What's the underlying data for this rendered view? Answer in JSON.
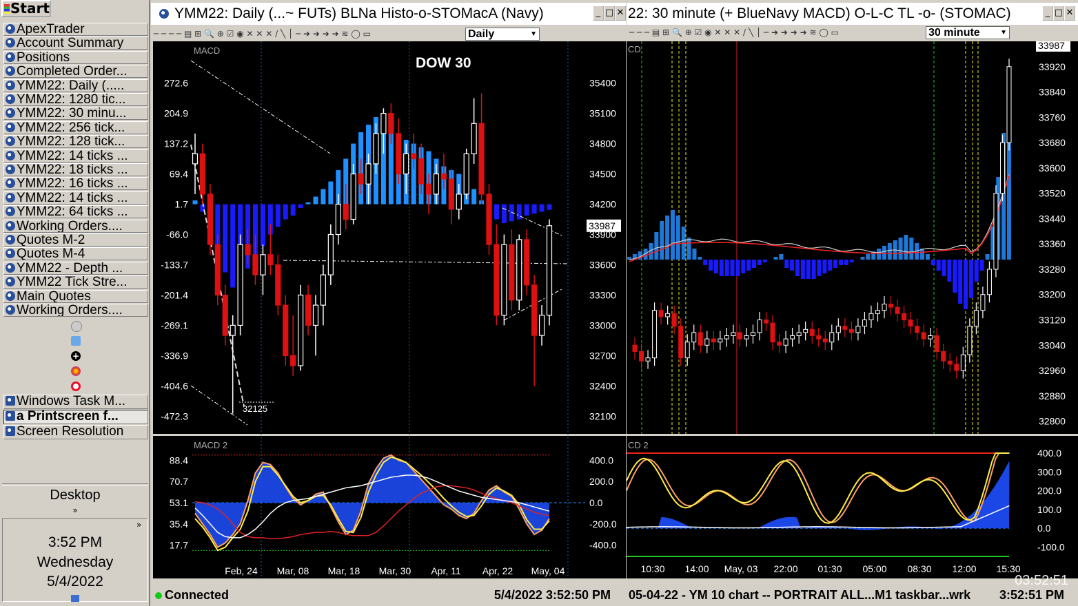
{
  "taskbar": {
    "start_label": "Start",
    "items": [
      {
        "label": "ApexTrader"
      },
      {
        "label": "Account Summary"
      },
      {
        "label": "Positions"
      },
      {
        "label": "Completed Order..."
      },
      {
        "label": "YMM22: Daily (....."
      },
      {
        "label": "YMM22: 1280 tic..."
      },
      {
        "label": "YMM22: 30 minu..."
      },
      {
        "label": "YMM22: 256 tick..."
      },
      {
        "label": "YMM22: 128 tick..."
      },
      {
        "label": "YMM22: 14 ticks ..."
      },
      {
        "label": "YMM22: 18 ticks ..."
      },
      {
        "label": "YMM22: 16 ticks ..."
      },
      {
        "label": "YMM22: 14 ticks ..."
      },
      {
        "label": "YMM22: 64 ticks ..."
      },
      {
        "label": "Working Orders...."
      },
      {
        "label": "Quotes M-2"
      },
      {
        "label": "Quotes M-4"
      },
      {
        "label": "YMM22 - Depth ..."
      },
      {
        "label": "YMM22 Tick Stre..."
      },
      {
        "label": "Main Quotes"
      },
      {
        "label": "Working Orders...."
      }
    ],
    "bottom_items": [
      {
        "label": "Windows Task M..."
      },
      {
        "label": "a Printscreen f..."
      },
      {
        "label": "Screen Resolution"
      }
    ],
    "desktop_label": "Desktop",
    "desktop_chevron": "»",
    "tray_chevron": "»",
    "clock": {
      "time": "3:52 PM",
      "day": "Wednesday",
      "date": "5/4/2022"
    }
  },
  "left_window": {
    "title": "YMM22: Daily (...~ FUTs) BLNa Histo-o-STOMacA (Navy)",
    "timeframe": "Daily",
    "chart_title": "DOW 30",
    "status_connected": "Connected",
    "status_time": "5/4/2022 3:52:50 PM"
  },
  "right_window": {
    "title": "22: 30 minute (+ BlueNavy MACD) O-L-C TL -o- (STOMAC)",
    "timeframe": "30 minute",
    "status_text": "05-04-22 -  YM 10 chart -- PORTRAIT ALL...M1 taskbar...wrk",
    "status_time": "3:52:51 PM",
    "clock_overlay": "03:52:51"
  },
  "colors": {
    "up": "#ffffff",
    "down": "#dd1111",
    "hist_up": "#1e90ff",
    "hist_down": "#1a1aff",
    "price_tag": "#ffffff"
  },
  "chart_data": [
    {
      "type": "candlestick",
      "title": "DOW 30",
      "panel_label": "MACD",
      "x_tick_labels": [
        "Feb, 24",
        "Mar, 08",
        "Mar, 18",
        "Mar, 30",
        "Apr, 11",
        "Apr, 22",
        "May, 04"
      ],
      "price_axis": [
        35400,
        35100,
        34800,
        34500,
        34200,
        33900,
        33600,
        33300,
        33000,
        32700,
        32400,
        32100
      ],
      "indicator_axis": [
        272.6,
        204.9,
        137.2,
        69.4,
        1.7,
        -66.0,
        -133.7,
        -201.4,
        -269.1,
        -336.9,
        -404.6,
        -472.3
      ],
      "ylim": [
        32000,
        35500
      ],
      "last_price": 33987,
      "annotation": "32125",
      "candles": [
        {
          "o": 34600,
          "h": 34900,
          "l": 34300,
          "c": 34700
        },
        {
          "o": 34700,
          "h": 34800,
          "l": 34200,
          "c": 34300
        },
        {
          "o": 34300,
          "h": 34400,
          "l": 33700,
          "c": 33800
        },
        {
          "o": 33800,
          "h": 33900,
          "l": 33200,
          "c": 33300
        },
        {
          "o": 33300,
          "h": 33400,
          "l": 32800,
          "c": 32900
        },
        {
          "o": 32900,
          "h": 33100,
          "l": 32125,
          "c": 33000
        },
        {
          "o": 33000,
          "h": 33900,
          "l": 32900,
          "c": 33800
        },
        {
          "o": 33800,
          "h": 33950,
          "l": 33600,
          "c": 33700
        },
        {
          "o": 33700,
          "h": 33900,
          "l": 33400,
          "c": 33500
        },
        {
          "o": 33500,
          "h": 33800,
          "l": 33300,
          "c": 33700
        },
        {
          "o": 33700,
          "h": 34000,
          "l": 33500,
          "c": 33600
        },
        {
          "o": 33600,
          "h": 33700,
          "l": 33100,
          "c": 33200
        },
        {
          "o": 33200,
          "h": 33300,
          "l": 32600,
          "c": 32700
        },
        {
          "o": 32700,
          "h": 33100,
          "l": 32500,
          "c": 32600
        },
        {
          "o": 32600,
          "h": 33400,
          "l": 32550,
          "c": 33300
        },
        {
          "o": 33300,
          "h": 33400,
          "l": 32900,
          "c": 33000
        },
        {
          "o": 33000,
          "h": 33300,
          "l": 32700,
          "c": 33200
        },
        {
          "o": 33200,
          "h": 33600,
          "l": 33000,
          "c": 33500
        },
        {
          "o": 33500,
          "h": 34000,
          "l": 33400,
          "c": 33900
        },
        {
          "o": 33900,
          "h": 34300,
          "l": 33800,
          "c": 34200
        },
        {
          "o": 34200,
          "h": 34400,
          "l": 33950,
          "c": 34050
        },
        {
          "o": 34050,
          "h": 34600,
          "l": 34000,
          "c": 34500
        },
        {
          "o": 34500,
          "h": 34650,
          "l": 34300,
          "c": 34400
        },
        {
          "o": 34400,
          "h": 34700,
          "l": 34200,
          "c": 34600
        },
        {
          "o": 34600,
          "h": 35000,
          "l": 34500,
          "c": 34900
        },
        {
          "o": 34900,
          "h": 35150,
          "l": 34700,
          "c": 35100
        },
        {
          "o": 35100,
          "h": 35200,
          "l": 34800,
          "c": 34900
        },
        {
          "o": 34900,
          "h": 35050,
          "l": 34400,
          "c": 34500
        },
        {
          "o": 34500,
          "h": 34800,
          "l": 34300,
          "c": 34700
        },
        {
          "o": 34700,
          "h": 34900,
          "l": 34550,
          "c": 34650
        },
        {
          "o": 34650,
          "h": 34800,
          "l": 34300,
          "c": 34400
        },
        {
          "o": 34400,
          "h": 34500,
          "l": 34100,
          "c": 34300
        },
        {
          "o": 34300,
          "h": 34600,
          "l": 34200,
          "c": 34500
        },
        {
          "o": 34500,
          "h": 34700,
          "l": 34350,
          "c": 34450
        },
        {
          "o": 34450,
          "h": 34550,
          "l": 34000,
          "c": 34150
        },
        {
          "o": 34150,
          "h": 34400,
          "l": 34050,
          "c": 34300
        },
        {
          "o": 34300,
          "h": 34750,
          "l": 34250,
          "c": 34700
        },
        {
          "o": 34700,
          "h": 35250,
          "l": 34600,
          "c": 35000
        },
        {
          "o": 35000,
          "h": 35300,
          "l": 34200,
          "c": 34300
        },
        {
          "o": 34300,
          "h": 34400,
          "l": 33700,
          "c": 33800
        },
        {
          "o": 33800,
          "h": 34000,
          "l": 33000,
          "c": 33100
        },
        {
          "o": 33100,
          "h": 33900,
          "l": 33000,
          "c": 33800
        },
        {
          "o": 33800,
          "h": 33950,
          "l": 33150,
          "c": 33250
        },
        {
          "o": 33250,
          "h": 33900,
          "l": 33150,
          "c": 33850
        },
        {
          "o": 33850,
          "h": 33950,
          "l": 33300,
          "c": 33400
        },
        {
          "o": 33400,
          "h": 33500,
          "l": 32400,
          "c": 32900
        },
        {
          "o": 32900,
          "h": 33200,
          "l": 32800,
          "c": 33100
        },
        {
          "o": 33100,
          "h": 34050,
          "l": 33000,
          "c": 33987
        }
      ],
      "histogram": [
        10,
        -20,
        -60,
        -120,
        -180,
        -220,
        -200,
        -170,
        -140,
        -110,
        -80,
        -60,
        -40,
        -30,
        -10,
        5,
        20,
        40,
        60,
        90,
        120,
        160,
        190,
        210,
        230,
        220,
        200,
        180,
        170,
        160,
        150,
        140,
        120,
        100,
        90,
        80,
        60,
        40,
        10,
        -20,
        -40,
        -50,
        -45,
        -40,
        -30,
        -25,
        -20,
        -15
      ]
    },
    {
      "type": "line",
      "panel_label": "MACD 2",
      "indicator_axis": [
        88.4,
        70.7,
        53.1,
        35.4,
        17.7
      ],
      "right_axis": [
        400.0,
        200.0,
        0.0,
        -200.0,
        -400.0
      ],
      "ylim": [
        -500,
        500
      ],
      "series": [
        {
          "values": [
            -100,
            -200,
            -300,
            -420,
            -380,
            -300,
            -200,
            20,
            280,
            380,
            360,
            280,
            150,
            40,
            -20,
            20,
            80,
            100,
            -40,
            -180,
            -300,
            -260,
            -80,
            180,
            320,
            420,
            450,
            400,
            380,
            300,
            220,
            140,
            60,
            -20,
            -60,
            -120,
            -150,
            -100,
            20,
            120,
            160,
            100,
            60,
            -60,
            -200,
            -300,
            -260,
            -150
          ]
        },
        {
          "values": [
            -150,
            -230,
            -330,
            -450,
            -420,
            -330,
            -250,
            -80,
            200,
            340,
            340,
            260,
            160,
            60,
            0,
            20,
            60,
            70,
            -20,
            -150,
            -270,
            -280,
            -140,
            100,
            260,
            380,
            430,
            410,
            380,
            320,
            260,
            190,
            120,
            40,
            -30,
            -90,
            -130,
            -120,
            -30,
            80,
            140,
            110,
            70,
            -20,
            -160,
            -250,
            -250,
            -170
          ]
        },
        {
          "values": [
            10,
            0,
            -20,
            -60,
            -120,
            -200,
            -280,
            -320,
            -330,
            -330,
            -340,
            -340,
            -330,
            -320,
            -300,
            -290,
            -280,
            -280,
            -270,
            -280,
            -300,
            -310,
            -310,
            -310,
            -280,
            -220,
            -150,
            -80,
            -20,
            40,
            90,
            120,
            150,
            160,
            160,
            150,
            140,
            120,
            90,
            60,
            40,
            20,
            0,
            -30,
            -60,
            -90,
            -110,
            -120
          ]
        },
        {
          "values": [
            -50,
            -120,
            -200,
            -280,
            -320,
            -330,
            -330,
            -300,
            -250,
            -180,
            -100,
            -40,
            0,
            20,
            30,
            40,
            60,
            80,
            100,
            120,
            140,
            150,
            160,
            180,
            200,
            220,
            240,
            250,
            260,
            260,
            250,
            230,
            200,
            170,
            140,
            110,
            90,
            70,
            50,
            40,
            30,
            20,
            10,
            0,
            -20,
            -40,
            -60,
            -80
          ]
        }
      ]
    },
    {
      "type": "candlestick",
      "price_axis": [
        33920,
        33840,
        33760,
        33680,
        33600,
        33520,
        33440,
        33360,
        33280,
        33200,
        33120,
        33040,
        32960,
        32880,
        32800
      ],
      "x_tick_labels": [
        "10:30",
        "14:00",
        "May, 03",
        "22:00",
        "01:30",
        "05:00",
        "08:30",
        "12:00",
        "15:30"
      ],
      "panel_label": "CD",
      "ylim": [
        32760,
        34000
      ],
      "last_price": 33987
    },
    {
      "type": "line",
      "panel_label": "CD 2",
      "right_axis": [
        400.0,
        300.0,
        200.0,
        100.0,
        0.0,
        -100.0
      ],
      "ylim": [
        -150,
        420
      ]
    }
  ]
}
